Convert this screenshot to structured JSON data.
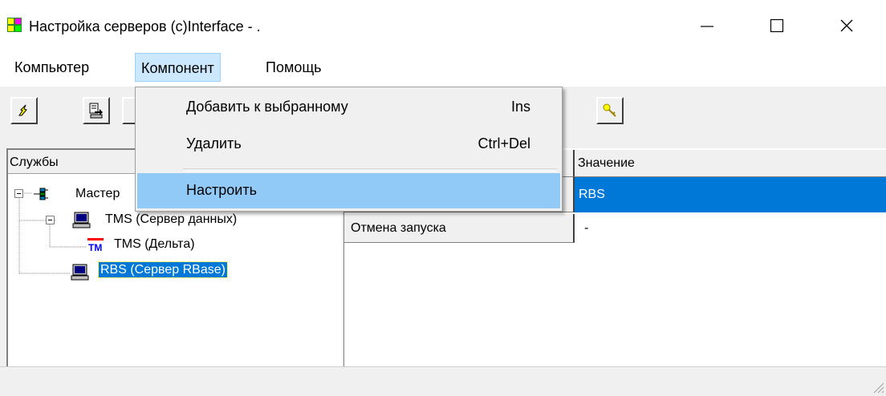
{
  "window": {
    "title": "Настройка серверов (c)Interface - .",
    "minimize_glyph": "—",
    "maximize_glyph": "☐",
    "close_glyph": "✕"
  },
  "menubar": {
    "items": [
      "Компьютер",
      "Компонент",
      "Помощь"
    ]
  },
  "dropdown": {
    "items": [
      {
        "label": "Добавить к выбранному",
        "shortcut": "Ins"
      },
      {
        "label": "Удалить",
        "shortcut": "Ctrl+Del"
      },
      {
        "label": "Настроить",
        "shortcut": ""
      }
    ],
    "highlighted_index": 2
  },
  "toolbar": {
    "buttons": [
      "connect-icon",
      "export-icon",
      "key-icon"
    ]
  },
  "tree": {
    "header": "Службы",
    "nodes": [
      {
        "label": "Мастер",
        "icon": "network-icon",
        "level": 0
      },
      {
        "label": "TMS (Сервер данных)",
        "icon": "computer-icon",
        "level": 1
      },
      {
        "label": "TMS (Дельта)",
        "icon": "tm-icon",
        "level": 2
      },
      {
        "label": "RBS (Сервер RBase)",
        "icon": "computer-icon",
        "level": 1,
        "selected": true
      }
    ]
  },
  "grid": {
    "value_header": "Значение",
    "rows": [
      {
        "name": "",
        "value": "RBS",
        "selected": true
      },
      {
        "name": "Отмена запуска",
        "value": "-"
      }
    ]
  },
  "colors": {
    "selection": "#0078d7",
    "menu_highlight": "#91c9f7",
    "menu_open": "#cce8ff"
  }
}
